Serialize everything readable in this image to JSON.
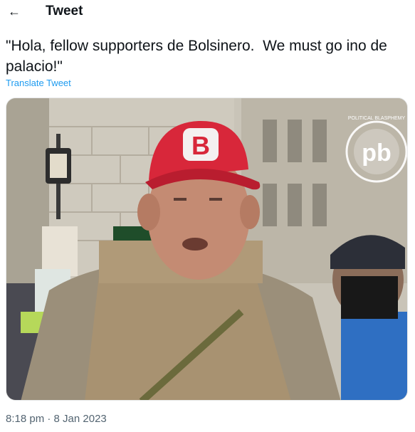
{
  "header": {
    "back_icon": "arrow-left-icon",
    "title": "Tweet"
  },
  "tweet": {
    "text": "\"Hola, fellow supporters de Bolsinero.  We must go ino de palacio!\"",
    "translate_label": "Translate Tweet",
    "time": "8:18 pm",
    "separator": "·",
    "date": "8 Jan 2023"
  },
  "media": {
    "cap_letter": "B",
    "watermark_text": "POLITICAL BLASPHEMY",
    "watermark_logo": "pb",
    "colors": {
      "cap": "#d8273a",
      "vest": "#a89271",
      "building": "#c8c3b6",
      "jacket": "#2f6fc2"
    }
  }
}
